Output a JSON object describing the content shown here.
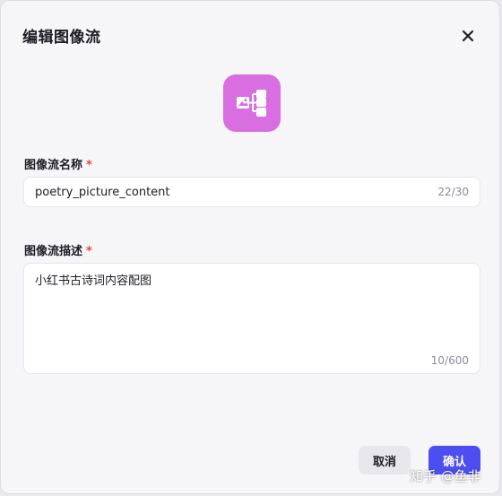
{
  "dialog": {
    "title": "编辑图像流",
    "close_icon": "close-icon"
  },
  "app_icon": {
    "icon": "image-flow-icon",
    "background": "#d96ee0"
  },
  "name_field": {
    "label": "图像流名称",
    "required_mark": "*",
    "value": "poetry_picture_content",
    "counter": "22/30"
  },
  "desc_field": {
    "label": "图像流描述",
    "required_mark": "*",
    "value": "小红书古诗词内容配图",
    "counter": "10/600"
  },
  "buttons": {
    "cancel_label": "取消",
    "confirm_label": "确认",
    "confirm_color": "#4c4ef0"
  },
  "watermark": {
    "text": "知乎 @鱼非"
  }
}
